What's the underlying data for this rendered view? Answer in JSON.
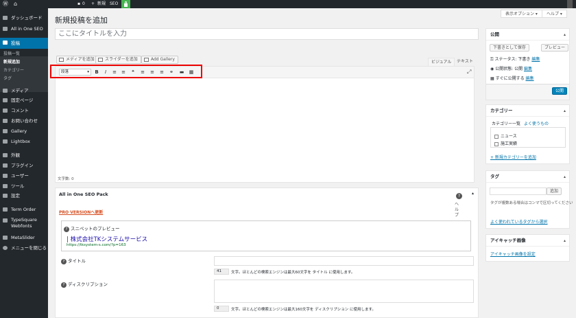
{
  "adminbar": {
    "comments": "0",
    "new_label": "新規",
    "seo_label": "SEO"
  },
  "menu": {
    "items": [
      {
        "label": "ダッシュボード"
      },
      {
        "label": "All in One SEO"
      },
      {
        "label": "投稿"
      },
      {
        "label": "メディア"
      },
      {
        "label": "固定ページ"
      },
      {
        "label": "コメント"
      },
      {
        "label": "お問い合わせ"
      },
      {
        "label": "Gallery"
      },
      {
        "label": "Lightbox"
      },
      {
        "label": "外観"
      },
      {
        "label": "プラグイン"
      },
      {
        "label": "ユーザー"
      },
      {
        "label": "ツール"
      },
      {
        "label": "設定"
      },
      {
        "label": "Term Order"
      },
      {
        "label": "TypeSquare Webfonts"
      },
      {
        "label": "MetaSlider"
      },
      {
        "label": "メニューを閉じる"
      }
    ],
    "submenu": [
      "投稿一覧",
      "新規追加",
      "カテゴリー",
      "タグ"
    ]
  },
  "screen_options": "表示オプション ▾",
  "help": "ヘルプ ▾",
  "page_title": "新規投稿を追加",
  "title_placeholder": "ここにタイトルを入力",
  "media_buttons": {
    "add_media": "メディアを追加",
    "add_slider": "スライダーを追加",
    "add_gallery": "Add Gallery"
  },
  "editor_tabs": {
    "visual": "ビジュアル",
    "text": "テキスト"
  },
  "format_select": "段落",
  "toolbar_glyphs": [
    "B",
    "I",
    "≡",
    "≡",
    "❝",
    "≡",
    "≡",
    "≡",
    "⚭",
    "▬",
    "▦"
  ],
  "word_count": "文字数: 0",
  "seo": {
    "title": "All in One SEO Pack",
    "help": "ヘルプ",
    "pro": "PRO VERSIONへ更新",
    "snippet_label": "スニペットのプレビュー",
    "snippet_title": "| 株式会社TKシステムサービス",
    "snippet_url": "https://tksystem-s.com/?p=163",
    "title_label": "タイトル",
    "title_count": "41",
    "title_help": "文字。ほとんどの検索エンジンは最大60文字を タイトル に使用します。",
    "desc_label": "ディスクリプション",
    "desc_count": "0",
    "desc_help": "文字。ほとんどの検索エンジンは最大160文字を ディスクリプション に使用します。"
  },
  "publish": {
    "title": "公開",
    "save_draft": "下書きとして保存",
    "preview": "プレビュー",
    "status": "ステータス: 下書き",
    "status_edit": "編集",
    "visibility": "公開状態: 公開",
    "vis_edit": "編集",
    "schedule": "すぐに公開する",
    "sched_edit": "編集",
    "publish_btn": "公開"
  },
  "category": {
    "title": "カテゴリー",
    "tab_all": "カテゴリー一覧",
    "tab_pop": "よく使うもの",
    "items": [
      "ニュース",
      "施工実績"
    ],
    "add": "+ 新規カテゴリーを追加"
  },
  "tags": {
    "title": "タグ",
    "add_btn": "追加",
    "help": "タグが複数ある場合はコンマで区切ってください",
    "popular": "よく使われているタグから選択"
  },
  "thumb": {
    "title": "アイキャッチ画像",
    "set": "アイキャッチ画像を設定"
  }
}
